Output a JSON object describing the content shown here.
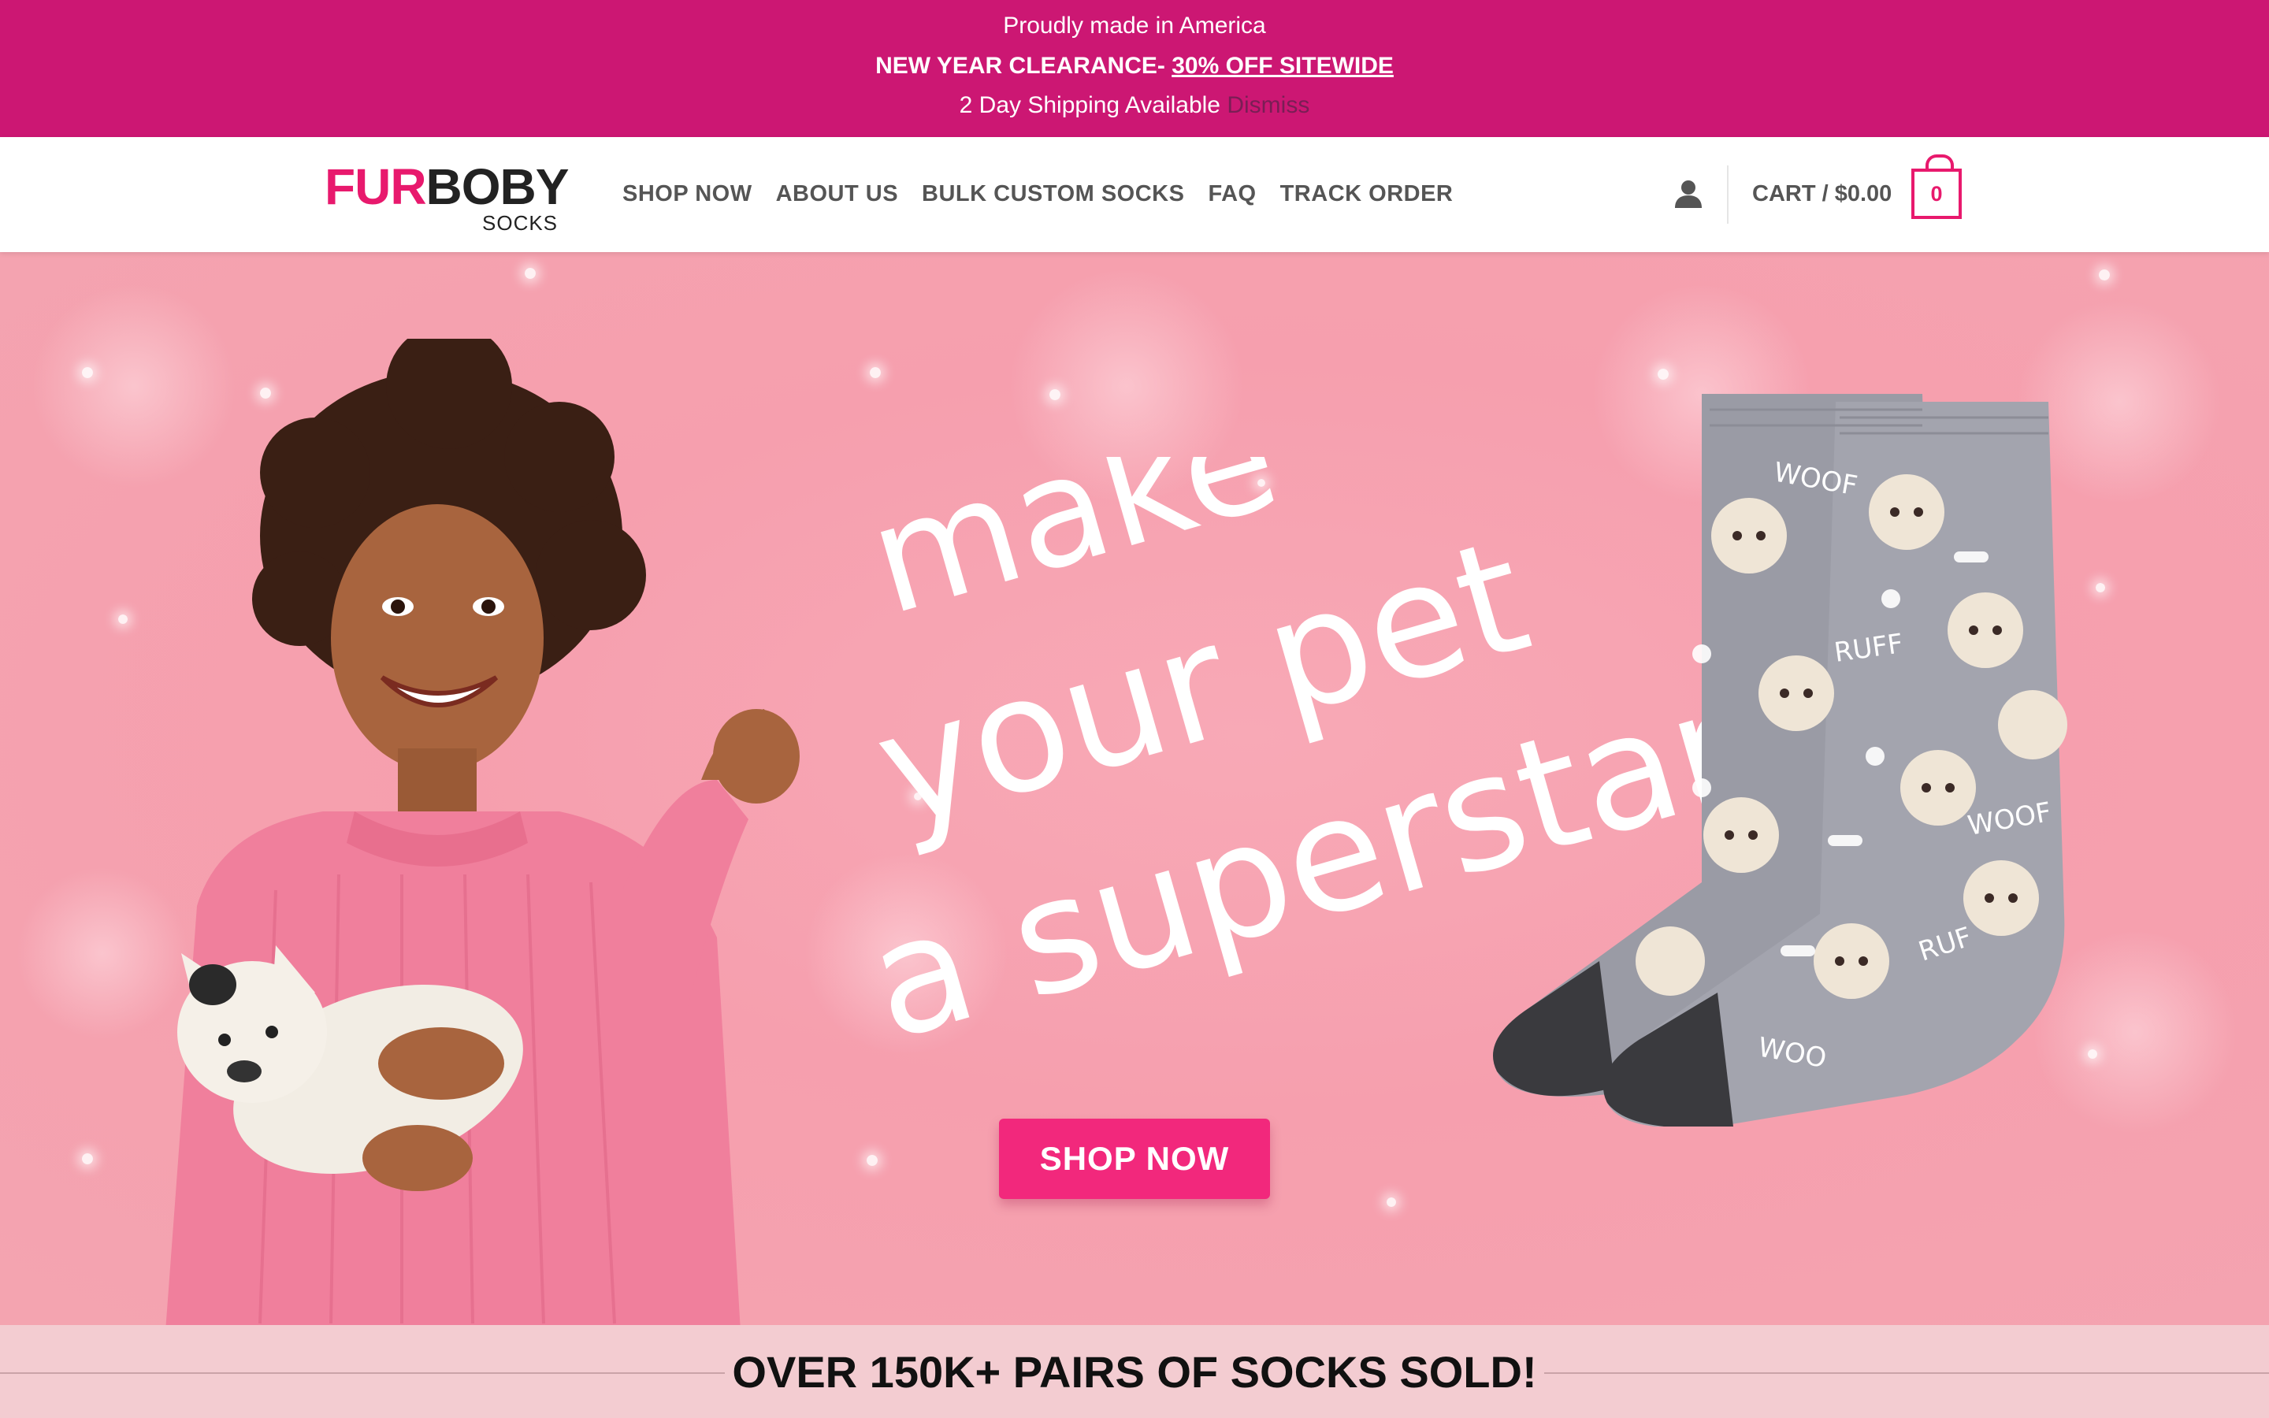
{
  "announcement": {
    "line1": "Proudly made in America",
    "line2_prefix": "NEW YEAR CLEARANCE-",
    "line2_link": "30% OFF SITEWIDE",
    "line3": "2 Day Shipping Available",
    "dismiss_label": "Dismiss",
    "bg_color": "#cc1773"
  },
  "header": {
    "logo": {
      "part1": "FUR",
      "part2": "BOBY",
      "sub": "SOCKS"
    },
    "nav": [
      {
        "label": "SHOP NOW"
      },
      {
        "label": "ABOUT US"
      },
      {
        "label": "BULK CUSTOM SOCKS"
      },
      {
        "label": "FAQ"
      },
      {
        "label": "TRACK ORDER"
      }
    ],
    "account_icon": "user-icon",
    "cart_label": "CART / $0.00",
    "cart_count": "0",
    "accent_color": "#e8196d"
  },
  "hero": {
    "tagline_line1": "make",
    "tagline_line2": "your pet",
    "tagline_line3": "a superstar",
    "cta_label": "SHOP NOW",
    "sock_print_words": [
      "WOOF",
      "RUFF",
      "WOOF",
      "RUF",
      "WOO"
    ]
  },
  "banner": {
    "text": "OVER 150K+ PAIRS OF SOCKS SOLD!"
  }
}
